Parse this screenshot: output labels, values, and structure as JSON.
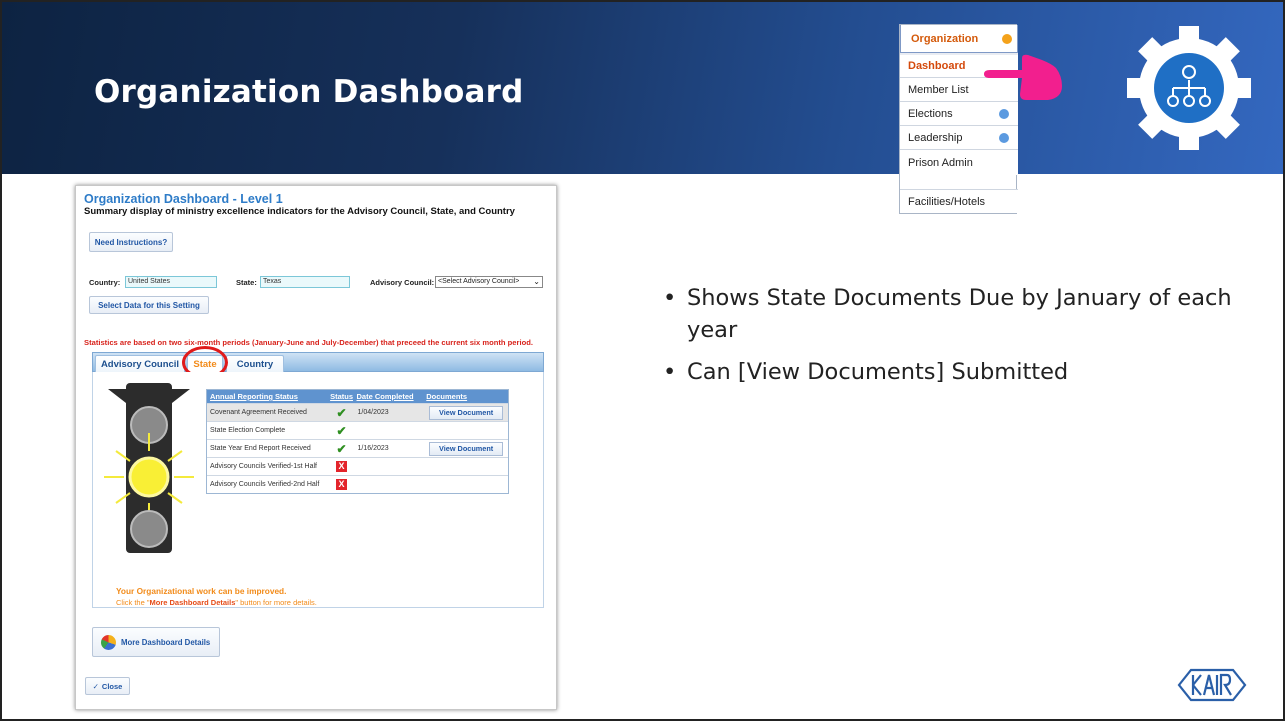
{
  "slide": {
    "title": "Organization Dashboard",
    "bullets": [
      "Shows State Documents Due by January of each year",
      "Can [View Documents] Submitted"
    ]
  },
  "nav_menu": {
    "items": [
      {
        "label": "Organization",
        "icon": "orange-dot-icon"
      },
      {
        "label": "Dashboard",
        "icon": "pointer-hand-icon"
      },
      {
        "label": "Member List"
      },
      {
        "label": "Elections",
        "icon": "blue-dot-icon"
      },
      {
        "label": "Leadership",
        "icon": "blue-dot-icon"
      },
      {
        "label": "Prison Admin"
      },
      {
        "label": "Facilities/Hotels"
      }
    ]
  },
  "app": {
    "title": "Organization Dashboard - Level 1",
    "subtitle": "Summary display of ministry excellence indicators for the Advisory Council, State, and Country",
    "need_instructions": "Need Instructions?",
    "country_label": "Country:",
    "country_value": "United States",
    "state_label": "State:",
    "state_value": "Texas",
    "council_label": "Advisory Council:",
    "council_value": "<Select Advisory Council>",
    "select_data": "Select Data for this Setting",
    "stats_note": "Statistics are based on two six-month periods (January-June and July-December) that preceed the current six month period.",
    "tabs": [
      "Advisory Council",
      "State",
      "Country"
    ],
    "table": {
      "headers": [
        "Annual Reporting Status",
        "Status",
        "Date Completed",
        "Documents"
      ],
      "rows": [
        {
          "item": "Covenant Agreement Received",
          "status": "check",
          "date": "1/04/2023",
          "doc": "View Document"
        },
        {
          "item": "State Election Complete",
          "status": "check",
          "date": "",
          "doc": ""
        },
        {
          "item": "State Year End Report Received",
          "status": "check",
          "date": "1/16/2023",
          "doc": "View Document"
        },
        {
          "item": "Advisory Councils Verified-1st Half",
          "status": "x",
          "date": "",
          "doc": ""
        },
        {
          "item": "Advisory Councils Verified-2nd Half",
          "status": "x",
          "date": "",
          "doc": ""
        }
      ]
    },
    "improve_msg": "Your Organizational work can be improved.",
    "improve_pre": "Click the \"",
    "improve_bold": "More Dashboard Details",
    "improve_post": "\" button for more details.",
    "more_details": "More Dashboard Details",
    "close": "Close"
  },
  "colors": {
    "header_dark": "#0d2342",
    "header_light": "#3468c0",
    "orange": "#f28b1a",
    "red": "#e01a1a",
    "tab_blue": "#1d4f8e"
  }
}
